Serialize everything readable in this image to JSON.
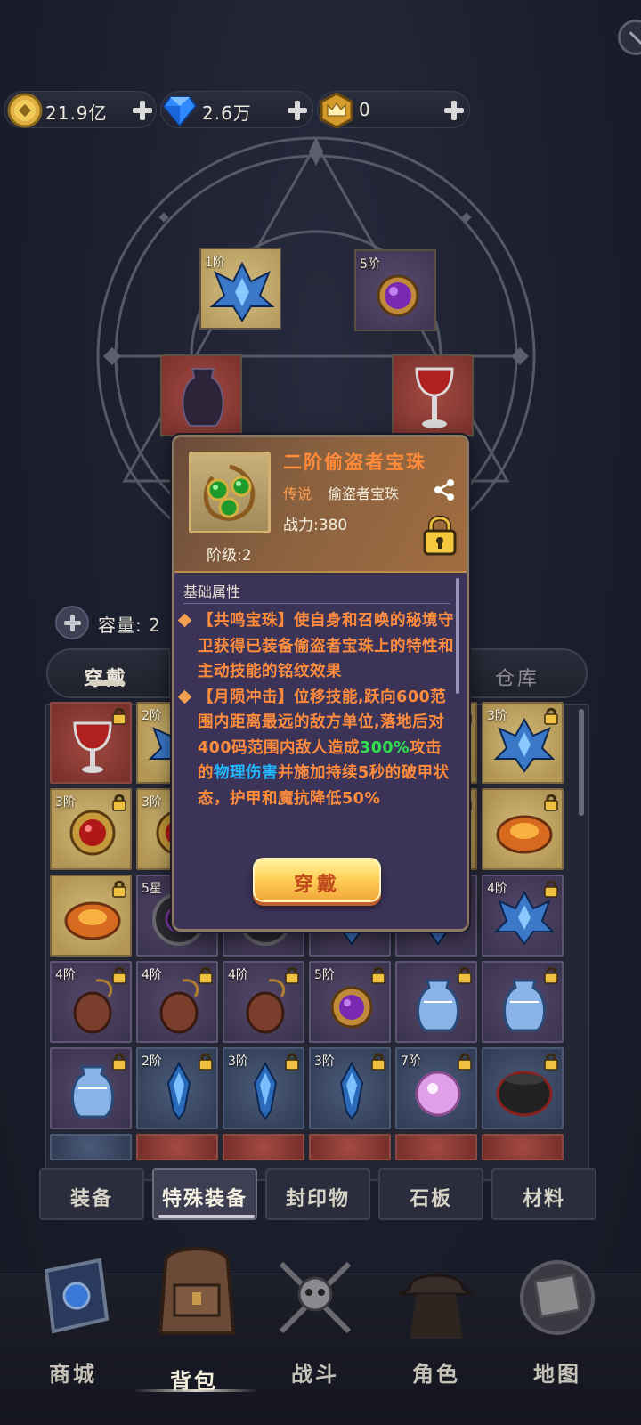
{
  "currency": {
    "gold": "21.9亿",
    "diamond": "2.6万",
    "crown": "0"
  },
  "top_slots": [
    {
      "grade": "1阶"
    },
    {
      "grade": "5阶"
    }
  ],
  "tooltip": {
    "name": "二阶偷盗者宝珠",
    "rarity": "传说",
    "type": "偷盗者宝珠",
    "power": "战力:380",
    "grade": "阶级:2",
    "section_title": "基础属性",
    "skill1_a": "【共鸣宝珠】使自身和召唤的秘境守卫获得已装备偷盗者宝珠上的特性和主动技能的铭纹效果",
    "skill2_a": "【月陨冲击】位移技能,跃向600范围内距离最远的敌方单位,落地后对400码范围内敌人造成",
    "skill2_pct": "300%",
    "skill2_mid": "攻击的",
    "skill2_dmg": "物理伤害",
    "skill2_b": "并施加持续5秒的破甲状",
    "skill2_c": "态，护甲和魔抗降低50%",
    "equip_label": "穿戴"
  },
  "capacity": {
    "label": "容量: 2"
  },
  "sub_tabs": {
    "wear": "穿戴",
    "warehouse": "仓库"
  },
  "grid": [
    {
      "grade": "",
      "kind": "red",
      "item": "chalice"
    },
    {
      "grade": "2阶",
      "kind": "gold",
      "item": "crystal"
    },
    {
      "grade": "",
      "kind": "gold",
      "item": "none"
    },
    {
      "grade": "",
      "kind": "gold",
      "item": "none"
    },
    {
      "grade": "",
      "kind": "gold",
      "item": "none"
    },
    {
      "grade": "3阶",
      "kind": "gold",
      "item": "crystal"
    },
    {
      "grade": "3阶",
      "kind": "gold",
      "item": "ruby-orb"
    },
    {
      "grade": "3阶",
      "kind": "gold",
      "item": "ruby-orb"
    },
    {
      "grade": "",
      "kind": "gold",
      "item": "none"
    },
    {
      "grade": "",
      "kind": "gold",
      "item": "none"
    },
    {
      "grade": "",
      "kind": "gold",
      "item": "none"
    },
    {
      "grade": "",
      "kind": "gold",
      "item": "amber-ring"
    },
    {
      "grade": "",
      "kind": "gold",
      "item": "amber-ring"
    },
    {
      "grade": "5星",
      "kind": "purple",
      "item": "dark-ring"
    },
    {
      "grade": "",
      "kind": "purple",
      "item": "dark-ring"
    },
    {
      "grade": "",
      "kind": "purple",
      "item": "crystal"
    },
    {
      "grade": "",
      "kind": "purple",
      "item": "crystal"
    },
    {
      "grade": "4阶",
      "kind": "purple",
      "item": "crystal"
    },
    {
      "grade": "4阶",
      "kind": "purple",
      "item": "pendant"
    },
    {
      "grade": "4阶",
      "kind": "purple",
      "item": "pendant"
    },
    {
      "grade": "4阶",
      "kind": "purple",
      "item": "pendant"
    },
    {
      "grade": "5阶",
      "kind": "purple",
      "item": "purple-orb"
    },
    {
      "grade": "",
      "kind": "purple",
      "item": "jar"
    },
    {
      "grade": "",
      "kind": "purple",
      "item": "jar"
    },
    {
      "grade": "",
      "kind": "purple",
      "item": "jar"
    },
    {
      "grade": "2阶",
      "kind": "blue",
      "item": "shard"
    },
    {
      "grade": "3阶",
      "kind": "blue",
      "item": "shard"
    },
    {
      "grade": "3阶",
      "kind": "blue",
      "item": "shard"
    },
    {
      "grade": "7阶",
      "kind": "blue",
      "item": "pink-orb"
    },
    {
      "grade": "",
      "kind": "blue",
      "item": "black-urn"
    }
  ],
  "category_tabs": [
    "装备",
    "特殊装备",
    "封印物",
    "石板",
    "材料"
  ],
  "bottom_nav": [
    {
      "label": "商城",
      "icon": "book-icon"
    },
    {
      "label": "背包",
      "icon": "backpack-icon"
    },
    {
      "label": "战斗",
      "icon": "crossed-swords-skull-icon"
    },
    {
      "label": "角色",
      "icon": "hooded-figure-icon"
    },
    {
      "label": "地图",
      "icon": "map-scroll-icon"
    }
  ],
  "colors": {
    "accent_orange": "#ff8a3a",
    "skill_green": "#2fe34e",
    "skill_blue": "#22b8ff",
    "button_gold": "#ffd25a"
  }
}
